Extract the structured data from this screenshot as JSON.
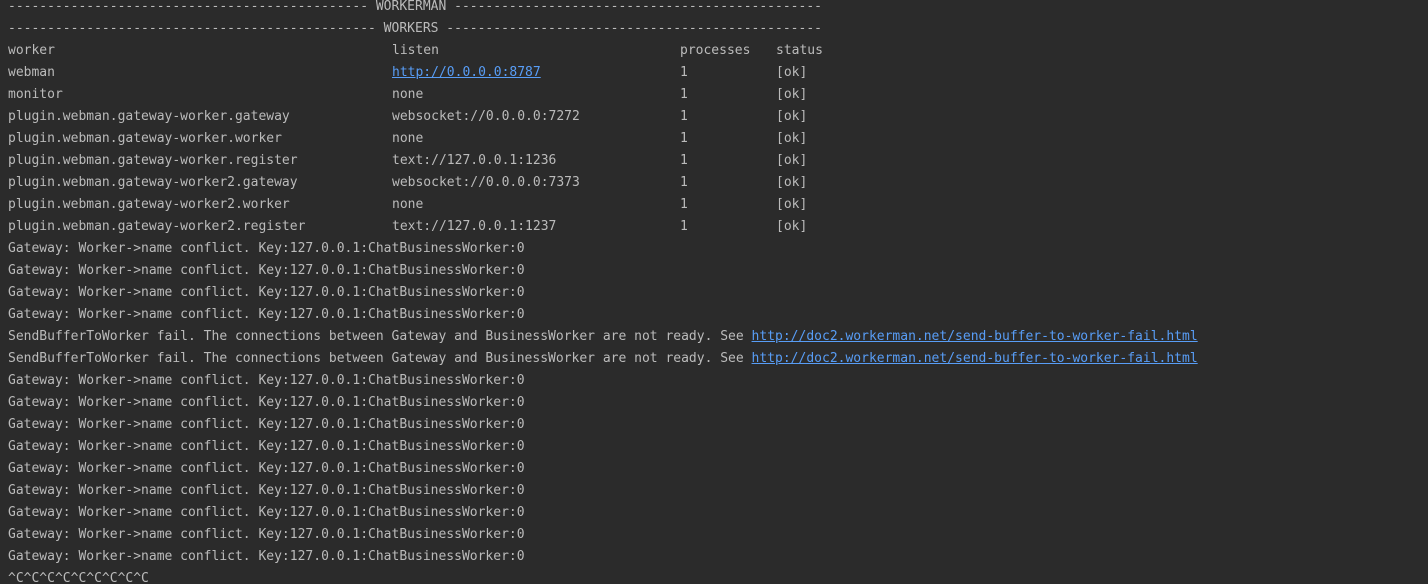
{
  "banner": {
    "workerman": "---------------------------------------------- WORKERMAN -----------------------------------------------",
    "workers": "----------------------------------------------- WORKERS ------------------------------------------------"
  },
  "table": {
    "headers": {
      "worker": "worker",
      "listen": "listen",
      "processes": "processes",
      "status": "status"
    },
    "rows": [
      {
        "worker": "webman",
        "listen": "http://0.0.0.0:8787",
        "processes": "1",
        "status": "[ok]"
      },
      {
        "worker": "monitor",
        "listen": "none",
        "processes": "1",
        "status": "[ok]"
      },
      {
        "worker": "plugin.webman.gateway-worker.gateway",
        "listen": "websocket://0.0.0.0:7272",
        "processes": "1",
        "status": "[ok]"
      },
      {
        "worker": "plugin.webman.gateway-worker.worker",
        "listen": "none",
        "processes": "1",
        "status": "[ok]"
      },
      {
        "worker": "plugin.webman.gateway-worker.register",
        "listen": "text://127.0.0.1:1236",
        "processes": "1",
        "status": "[ok]"
      },
      {
        "worker": "plugin.webman.gateway-worker2.gateway",
        "listen": "websocket://0.0.0.0:7373",
        "processes": "1",
        "status": "[ok]"
      },
      {
        "worker": "plugin.webman.gateway-worker2.worker",
        "listen": "none",
        "processes": "1",
        "status": "[ok]"
      },
      {
        "worker": "plugin.webman.gateway-worker2.register",
        "listen": "text://127.0.0.1:1237",
        "processes": "1",
        "status": "[ok]"
      }
    ]
  },
  "log": {
    "conflict": "Gateway: Worker->name conflict. Key:127.0.0.1:ChatBusinessWorker:0",
    "send_fail_text": "SendBufferToWorker fail. The connections between Gateway and BusinessWorker are not ready. See ",
    "send_fail_url": "http://doc2.workerman.net/send-buffer-to-worker-fail.html"
  },
  "interrupt": "^C^C^C^C^C^C^C^C^C",
  "colors": {
    "background": "#2b2b2b",
    "text": "#bbbbbb",
    "link": "#589df6"
  }
}
